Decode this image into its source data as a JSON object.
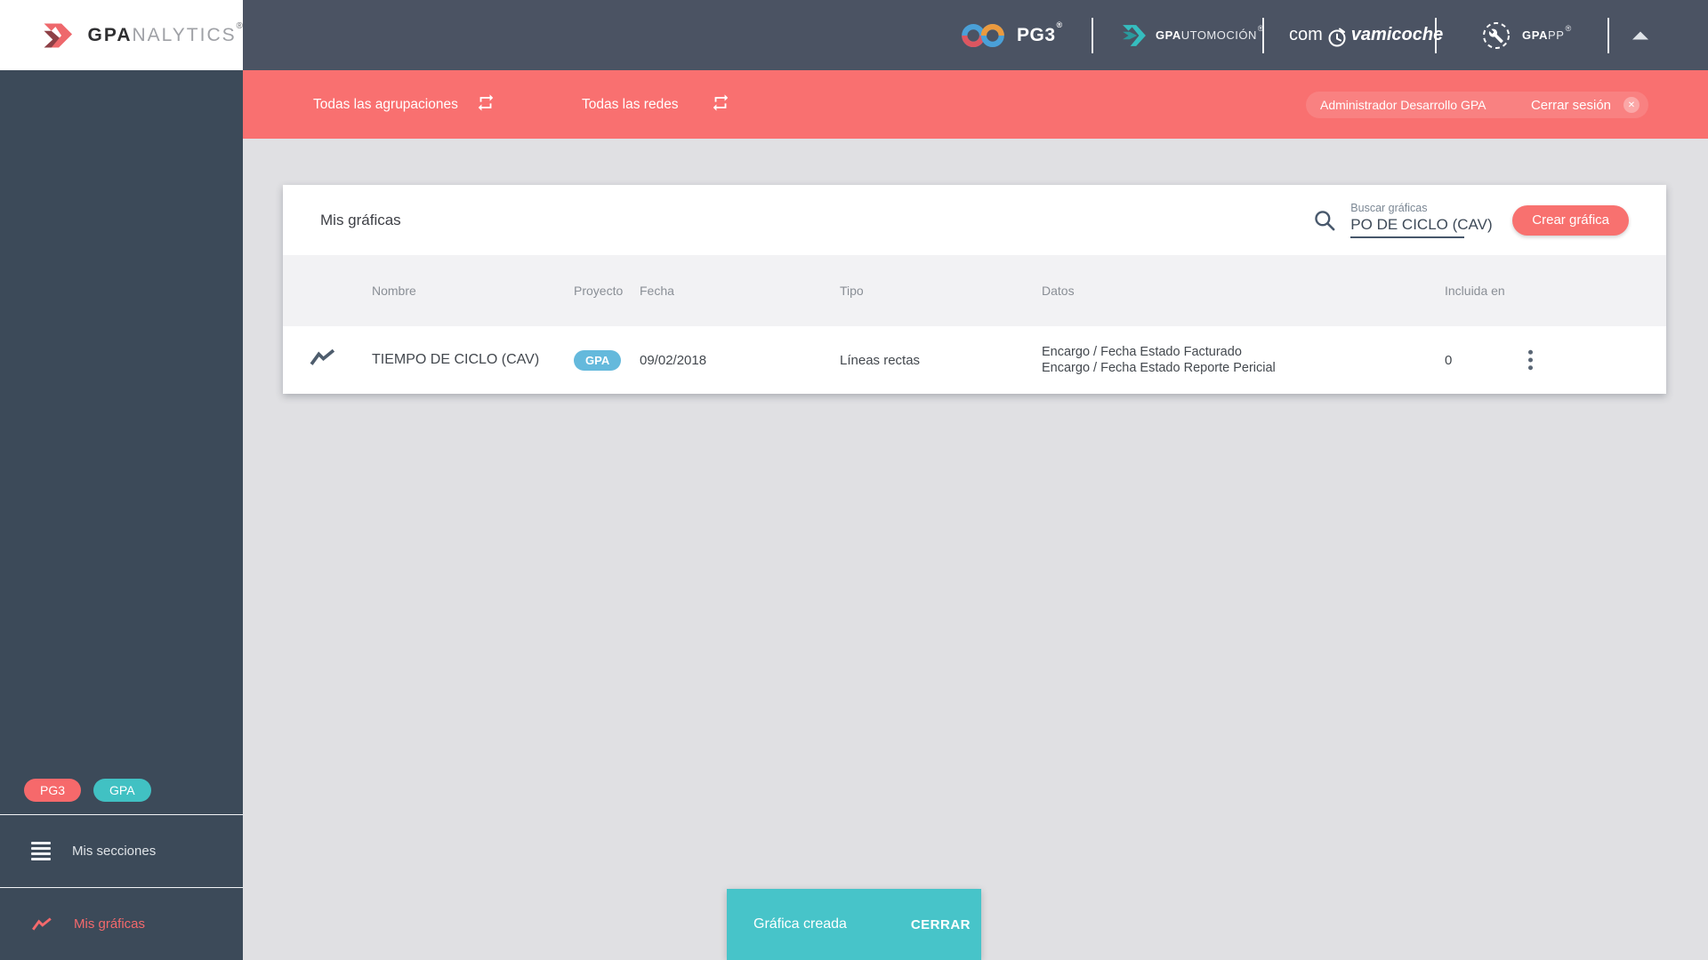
{
  "colors": {
    "header_slate": "#4b5363",
    "sidebar_slate": "#3c4a59",
    "bar_coral": "#f97070",
    "button_coral": "#f8716f",
    "toast_teal": "#47c4c9",
    "badge_blue": "#64b9dc",
    "badge_teal": "#41c1c3",
    "badge_coral": "#f6696b",
    "active_link_coral": "#f4696c"
  },
  "logo": {
    "bold": "GPA",
    "light": "NALYTICS",
    "reg": "®"
  },
  "header": {
    "pg3": {
      "label": "PG3",
      "reg": "®"
    },
    "gpautomocion": {
      "bold": "GPA",
      "light": "UTOMOCIÓN",
      "reg": "®"
    },
    "comprovamicoche": {
      "pre": "com",
      "post": "vamicoche"
    },
    "gpapp": {
      "bold": "GPA",
      "light": "PP",
      "reg": "®"
    }
  },
  "topbar": {
    "filter_groups": "Todas las agrupaciones",
    "filter_networks": "Todas las redes",
    "user": "Administrador Desarrollo GPA",
    "logout": "Cerrar sesión",
    "logout_x": "✕"
  },
  "sidebar": {
    "badge_pg3": "PG3",
    "badge_gpa": "GPA",
    "item_sections": "Mis secciones",
    "item_charts": "Mis gráficas"
  },
  "page": {
    "title": "Mis gráficas",
    "search_label": "Buscar gráficas",
    "search_value": "PO DE CICLO (CAV)",
    "create_button": "Crear gráfica"
  },
  "table": {
    "columns": [
      "Nombre",
      "Proyecto",
      "Fecha",
      "Tipo",
      "Datos",
      "Incluida en"
    ],
    "row": {
      "name": "TIEMPO DE CICLO (CAV)",
      "project_badge": "GPA",
      "date": "09/02/2018",
      "type": "Líneas rectas",
      "data_line1": "Encargo / Fecha Estado Facturado",
      "data_line2": "Encargo / Fecha Estado Reporte Pericial",
      "included_in": "0"
    }
  },
  "toast": {
    "message": "Gráfica creada",
    "action": "CERRAR"
  }
}
